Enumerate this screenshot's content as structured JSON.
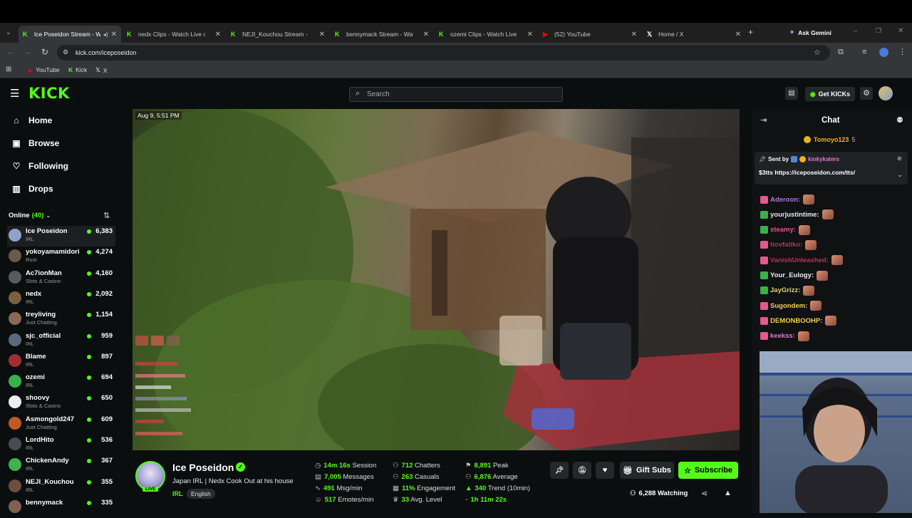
{
  "browser": {
    "tabs": [
      {
        "title": "Ice Poseidon Stream - W",
        "favicon": "kick",
        "active": true
      },
      {
        "title": "nedx Clips - Watch Live on",
        "favicon": "kick",
        "active": false
      },
      {
        "title": "NEJI_Kouchou Stream - Wat",
        "favicon": "kick",
        "active": false
      },
      {
        "title": "bennymack Stream - Watch",
        "favicon": "kick",
        "active": false
      },
      {
        "title": "ozemi Clips - Watch Live or",
        "favicon": "kick",
        "active": false
      },
      {
        "title": "(52) YouTube",
        "favicon": "youtube",
        "active": false
      },
      {
        "title": "Home / X",
        "favicon": "x",
        "active": false
      }
    ],
    "ask_gemini": "Ask Gemini",
    "url": "kick.com/iceposeidon",
    "bookmarks": [
      "YouTube",
      "Kick",
      "X"
    ]
  },
  "header": {
    "logo": "KICK",
    "search_placeholder": "Search",
    "get_kicks": "Get KICKs"
  },
  "sidebar": {
    "nav": [
      "Home",
      "Browse",
      "Following",
      "Drops"
    ],
    "online_label": "Online",
    "online_count": "(40)",
    "channels": [
      {
        "name": "Ice Poseidon",
        "category": "IRL",
        "viewers": "6,383",
        "color": "#8fa3c8"
      },
      {
        "name": "yokoyamamidori",
        "category": "Rust",
        "viewers": "4,274",
        "color": "#6b5a4a"
      },
      {
        "name": "Ac7ionMan",
        "category": "Slots & Casino",
        "viewers": "4,160",
        "color": "#5a5a5a"
      },
      {
        "name": "nedx",
        "category": "IRL",
        "viewers": "2,092",
        "color": "#7a6040"
      },
      {
        "name": "treyliving",
        "category": "Just Chatting",
        "viewers": "1,154",
        "color": "#8a6a55"
      },
      {
        "name": "sjc_official",
        "category": "IRL",
        "viewers": "959",
        "color": "#5c6a7a"
      },
      {
        "name": "Blame",
        "category": "IRL",
        "viewers": "897",
        "color": "#a03030"
      },
      {
        "name": "ozemi",
        "category": "IRL",
        "viewers": "694",
        "color": "#3ab04a"
      },
      {
        "name": "shoovy",
        "category": "Slots & Casino",
        "viewers": "650",
        "color": "#eeeeee"
      },
      {
        "name": "Asmongold247",
        "category": "Just Chatting",
        "viewers": "609",
        "color": "#c05a20"
      },
      {
        "name": "LordHito",
        "category": "IRL",
        "viewers": "536",
        "color": "#4a4a55"
      },
      {
        "name": "ChickenAndy",
        "category": "IRL",
        "viewers": "367",
        "color": "#40b050"
      },
      {
        "name": "NEJI_Kouchou",
        "category": "IRL",
        "viewers": "355",
        "color": "#6a5040"
      },
      {
        "name": "bennymack",
        "category": "",
        "viewers": "335",
        "color": "#806050"
      }
    ]
  },
  "video": {
    "timestamp": "Aug 9, 5:51 PM"
  },
  "stream": {
    "streamer": "Ice Poseidon",
    "title": "Japan IRL | Nedx Cook Out at his house",
    "live_badge": "LIVE",
    "category": "IRL",
    "language": "English",
    "stats": [
      {
        "icon": "clock",
        "value": "14m 16s",
        "label": "Session"
      },
      {
        "icon": "chat",
        "value": "7,005",
        "label": "Messages"
      },
      {
        "icon": "pulse",
        "value": "491",
        "label": "Msg/min"
      },
      {
        "icon": "smile",
        "value": "517",
        "label": "Emotes/min"
      },
      {
        "icon": "users",
        "value": "712",
        "label": "Chatters"
      },
      {
        "icon": "users",
        "value": "263",
        "label": "Casuals"
      },
      {
        "icon": "bars",
        "value": "11%",
        "label": "Engagement"
      },
      {
        "icon": "trophy",
        "value": "33",
        "label": "Avg. Level"
      },
      {
        "icon": "peak",
        "value": "8,891",
        "label": "Peak"
      },
      {
        "icon": "avg",
        "value": "6,876",
        "label": "Average"
      },
      {
        "icon": "trend",
        "value": "340",
        "label": "Trend (10min)"
      },
      {
        "icon": "time",
        "value": "1h 11m 22s",
        "label": ""
      }
    ],
    "gift_subs": "Gift Subs",
    "subscribe": "Subscribe",
    "watching": "6,288 Watching"
  },
  "chat": {
    "title": "Chat",
    "pinned_user": "Tomoyo123",
    "pinned_count": "5",
    "sent_by_label": "Sent by",
    "sent_by_user": "kinkykaters",
    "pinned_message": "$3tts https://iceposeidon.com/tts/",
    "messages": [
      {
        "user": "Aderoon:",
        "color": "#b07ad8"
      },
      {
        "user": "yourjustintime:",
        "color": "#e8e8e8"
      },
      {
        "user": "steamy:",
        "color": "#e05a8a"
      },
      {
        "user": "tiovfatiko:",
        "color": "#c03050"
      },
      {
        "user": "VanishUnleashed:",
        "color": "#c03050"
      },
      {
        "user": "Your_Eulogy:",
        "color": "#f0f0f0"
      },
      {
        "user": "JayGrizz:",
        "color": "#d8d870"
      },
      {
        "user": "Sugondem:",
        "color": "#f0d050"
      },
      {
        "user": "DEMONBOOHP:",
        "color": "#f0d050"
      },
      {
        "user": "keekss:",
        "color": "#e07ac8"
      }
    ]
  },
  "colors": {
    "brand_green": "#53fc18"
  }
}
